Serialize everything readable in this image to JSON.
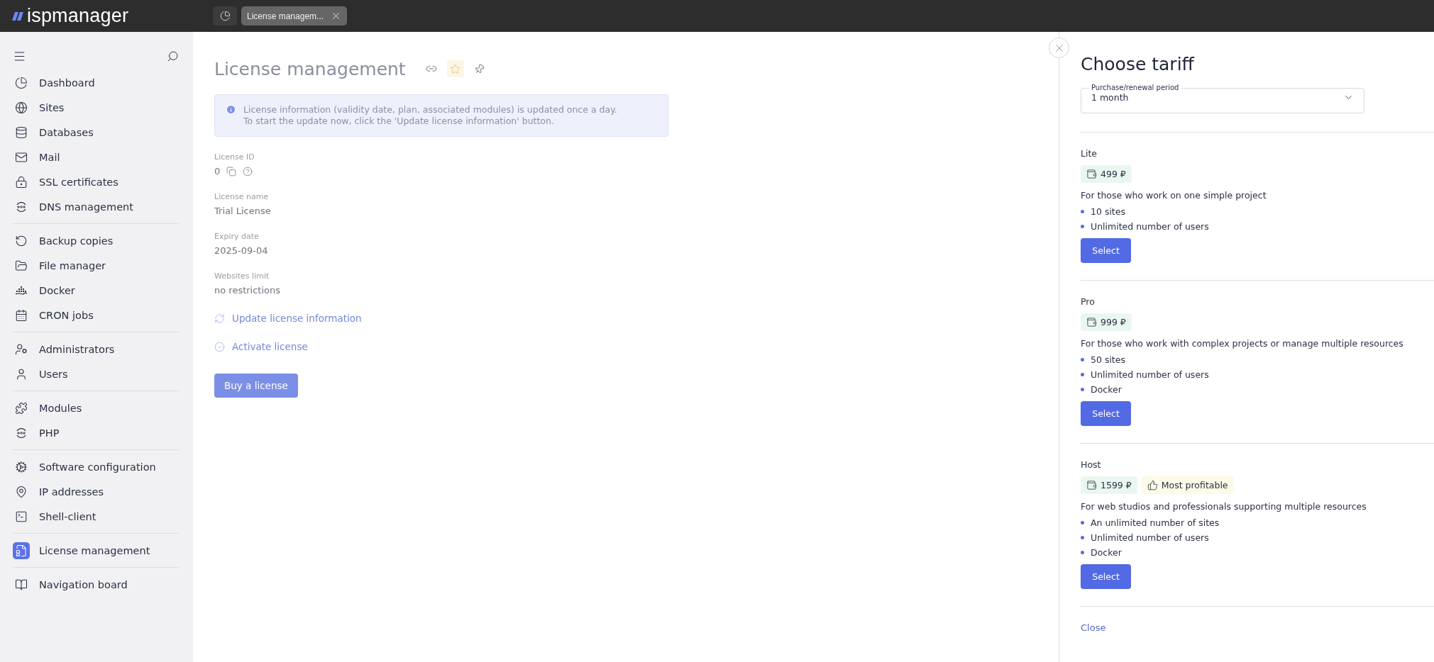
{
  "topbar": {
    "logo": "ispmanager",
    "tabs": [
      {
        "kind": "home",
        "selected": false
      },
      {
        "kind": "page",
        "label": "License managem...",
        "selected": true
      }
    ]
  },
  "sidebar": {
    "groups": [
      [
        {
          "label": "Dashboard",
          "selected": false
        },
        {
          "label": "Sites",
          "selected": false
        },
        {
          "label": "Databases",
          "selected": false
        },
        {
          "label": "Mail",
          "selected": false
        },
        {
          "label": "SSL certificates",
          "selected": false
        },
        {
          "label": "DNS management",
          "selected": false
        }
      ],
      [
        {
          "label": "Backup copies",
          "selected": false
        },
        {
          "label": "File manager",
          "selected": false
        },
        {
          "label": "Docker",
          "selected": false
        },
        {
          "label": "CRON jobs",
          "selected": false
        }
      ],
      [
        {
          "label": "Administrators",
          "selected": false
        },
        {
          "label": "Users",
          "selected": false
        }
      ],
      [
        {
          "label": "Modules",
          "selected": false
        },
        {
          "label": "PHP",
          "selected": false
        }
      ],
      [
        {
          "label": "Software configuration",
          "selected": false
        },
        {
          "label": "IP addresses",
          "selected": false
        },
        {
          "label": "Shell-client",
          "selected": false
        }
      ],
      [
        {
          "label": "License management",
          "selected": true
        }
      ],
      [
        {
          "label": "Navigation board",
          "selected": false
        }
      ]
    ]
  },
  "main": {
    "title": "License management",
    "info_lines": [
      "License information (validity date, plan, associated modules) is updated once a day.",
      "To start the update now, click the 'Update license information' button."
    ],
    "fields": [
      {
        "label": "License ID",
        "value": "0",
        "kind": "id"
      },
      {
        "label": "License name",
        "value": "Trial License",
        "kind": "text"
      },
      {
        "label": "Expiry date",
        "value": "2025-09-04",
        "kind": "text"
      },
      {
        "label": "Websites limit",
        "value": "no restrictions",
        "kind": "text"
      }
    ],
    "actions": [
      {
        "kind": "refresh",
        "label": "Update license information"
      },
      {
        "kind": "check",
        "label": "Activate license"
      }
    ],
    "buy_button": "Buy a license"
  },
  "panel": {
    "title": "Choose tariff",
    "period": {
      "label": "Purchase/renewal period",
      "value": "1 month"
    },
    "plans": [
      {
        "name": "Lite",
        "price": "499 ₽",
        "description": "For those who work on one simple project",
        "features": [
          "10 sites",
          "Unlimited number of users"
        ],
        "button": "Select"
      },
      {
        "name": "Pro",
        "price": "999 ₽",
        "description": "For those who work with complex projects or manage multiple resources",
        "features": [
          "50 sites",
          "Unlimited number of users",
          "Docker"
        ],
        "button": "Select"
      },
      {
        "name": "Host",
        "price": "1599 ₽",
        "badge": "Most profitable",
        "description": "For web studios and professionals supporting multiple resources",
        "features": [
          "An unlimited number of sites",
          "Unlimited number of users",
          "Docker"
        ],
        "button": "Select"
      }
    ],
    "close": "Close"
  }
}
